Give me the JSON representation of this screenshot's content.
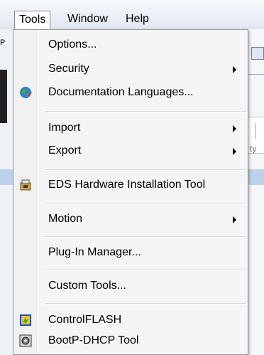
{
  "menubar": {
    "tools": "Tools",
    "window": "Window",
    "help": "Help"
  },
  "background": {
    "left_fragment": "P",
    "right_fragment": "ty"
  },
  "menu": {
    "options": "Options...",
    "security": "Security",
    "doc_languages": "Documentation Languages...",
    "import": "Import",
    "export": "Export",
    "eds_tool": "EDS Hardware Installation Tool",
    "motion": "Motion",
    "plugin_manager": "Plug-In Manager...",
    "custom_tools": "Custom Tools...",
    "controlflash": "ControlFLASH",
    "bootp": "BootP-DHCP Tool"
  },
  "icons": {
    "doc_languages": "globe-icon",
    "eds_tool": "installer-icon",
    "controlflash": "controlflash-icon",
    "bootp": "network-tool-icon"
  },
  "colors": {
    "menu_bg": "#f5f5f5",
    "highlight_border": "#7d8792",
    "separator": "#d9d9d9"
  }
}
